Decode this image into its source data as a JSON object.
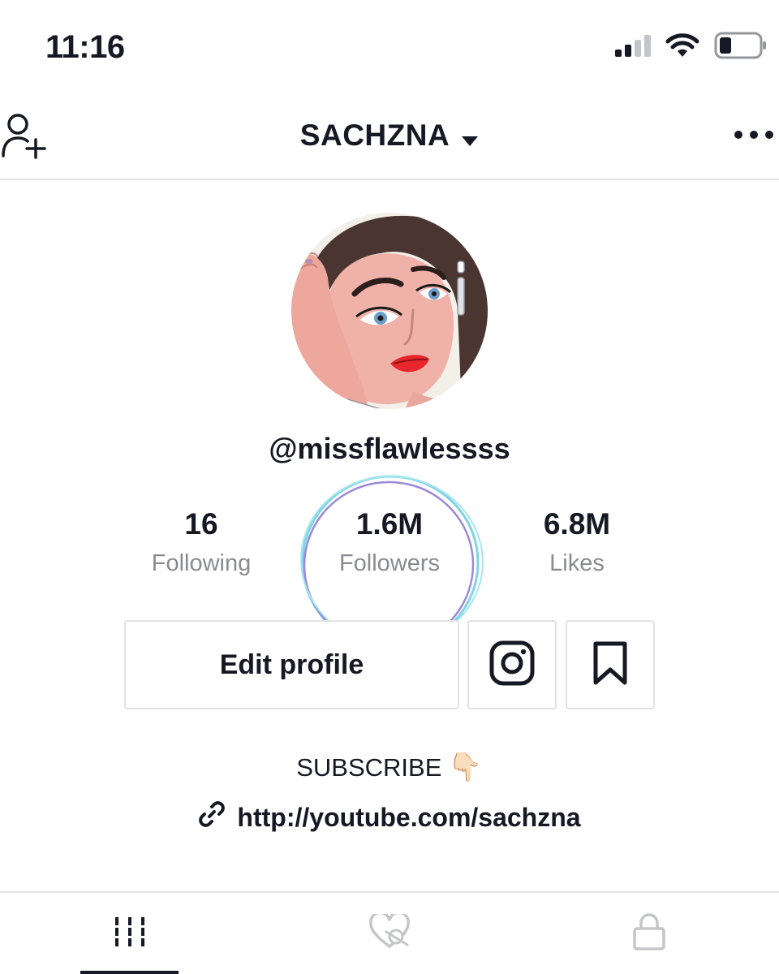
{
  "status_bar": {
    "time": "11:16",
    "icons": [
      "signal-icon",
      "wifi-icon",
      "battery-icon"
    ]
  },
  "header": {
    "title": "SACHZNA",
    "left_icon": "add-friend-icon",
    "title_icon": "caret-down-icon",
    "right_icon": "more-icon"
  },
  "profile": {
    "username": "@missflawlessss",
    "stats": [
      {
        "value": "16",
        "label": "Following"
      },
      {
        "value": "1.6M",
        "label": "Followers"
      },
      {
        "value": "6.8M",
        "label": "Likes"
      }
    ],
    "edit_button": "Edit profile",
    "bio": "SUBSCRIBE",
    "bio_emoji": "👇🏻",
    "link": "http://youtube.com/sachzna"
  },
  "tabs": [
    {
      "icon": "grid-icon",
      "active": true
    },
    {
      "icon": "liked-hidden-icon",
      "active": false
    },
    {
      "icon": "lock-icon",
      "active": false
    }
  ],
  "colors": {
    "text": "#161823",
    "secondary": "#8a8b91",
    "border": "#e3e3e4",
    "inactive_icon": "#c5c6c9",
    "lips": "#e8262b",
    "circle_annotation": "#7fd4e6"
  }
}
